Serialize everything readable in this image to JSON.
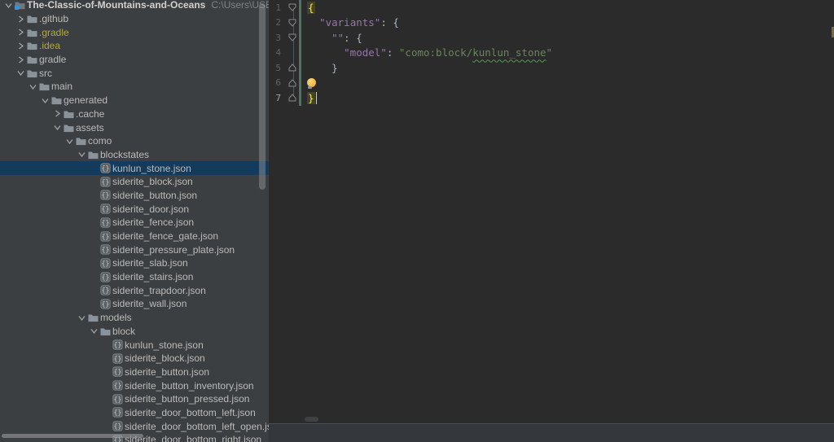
{
  "colors": {
    "panel_bg": "#3C3F41",
    "editor_bg": "#2B2B2B",
    "selection_bg": "#153B5C",
    "excluded_folder": "#B2A943",
    "key": "#9876AA",
    "string": "#6A8759",
    "punct": "#A9B7C6",
    "brace_match": "#FFEF28",
    "line_number": "#606366",
    "vcs_added_stripe": "#4E7560",
    "folder_icon": "#8A939A",
    "root_accent": "#3C8FD2"
  },
  "project_tree": {
    "rows": [
      {
        "label": "The-Classic-of-Mountains-and-Oceans",
        "path": "C:\\Users\\USER\\Deskto",
        "level": 0,
        "kind": "root",
        "state": "expanded"
      },
      {
        "label": ".github",
        "level": 1,
        "kind": "folder",
        "state": "collapsed"
      },
      {
        "label": ".gradle",
        "level": 1,
        "kind": "folder",
        "state": "collapsed",
        "excluded": true
      },
      {
        "label": ".idea",
        "level": 1,
        "kind": "folder",
        "state": "collapsed",
        "excluded": true
      },
      {
        "label": "gradle",
        "level": 1,
        "kind": "folder",
        "state": "collapsed"
      },
      {
        "label": "src",
        "level": 1,
        "kind": "folder",
        "state": "expanded"
      },
      {
        "label": "main",
        "level": 2,
        "kind": "folder",
        "state": "expanded"
      },
      {
        "label": "generated",
        "level": 3,
        "kind": "folder",
        "state": "expanded"
      },
      {
        "label": ".cache",
        "level": 4,
        "kind": "folder",
        "state": "collapsed"
      },
      {
        "label": "assets",
        "level": 4,
        "kind": "folder",
        "state": "expanded"
      },
      {
        "label": "como",
        "level": 5,
        "kind": "folder",
        "state": "expanded"
      },
      {
        "label": "blockstates",
        "level": 6,
        "kind": "folder",
        "state": "expanded"
      },
      {
        "label": "kunlun_stone.json",
        "level": 7,
        "kind": "file",
        "selected": true
      },
      {
        "label": "siderite_block.json",
        "level": 7,
        "kind": "file"
      },
      {
        "label": "siderite_button.json",
        "level": 7,
        "kind": "file"
      },
      {
        "label": "siderite_door.json",
        "level": 7,
        "kind": "file"
      },
      {
        "label": "siderite_fence.json",
        "level": 7,
        "kind": "file"
      },
      {
        "label": "siderite_fence_gate.json",
        "level": 7,
        "kind": "file"
      },
      {
        "label": "siderite_pressure_plate.json",
        "level": 7,
        "kind": "file"
      },
      {
        "label": "siderite_slab.json",
        "level": 7,
        "kind": "file"
      },
      {
        "label": "siderite_stairs.json",
        "level": 7,
        "kind": "file"
      },
      {
        "label": "siderite_trapdoor.json",
        "level": 7,
        "kind": "file"
      },
      {
        "label": "siderite_wall.json",
        "level": 7,
        "kind": "file"
      },
      {
        "label": "models",
        "level": 6,
        "kind": "folder",
        "state": "expanded"
      },
      {
        "label": "block",
        "level": 7,
        "kind": "folder",
        "state": "expanded"
      },
      {
        "label": "kunlun_stone.json",
        "level": 8,
        "kind": "file"
      },
      {
        "label": "siderite_block.json",
        "level": 8,
        "kind": "file"
      },
      {
        "label": "siderite_button.json",
        "level": 8,
        "kind": "file"
      },
      {
        "label": "siderite_button_inventory.json",
        "level": 8,
        "kind": "file"
      },
      {
        "label": "siderite_button_pressed.json",
        "level": 8,
        "kind": "file"
      },
      {
        "label": "siderite_door_bottom_left.json",
        "level": 8,
        "kind": "file"
      },
      {
        "label": "siderite_door_bottom_left_open.json",
        "level": 8,
        "kind": "file"
      },
      {
        "label": "siderite_door_bottom_right.json",
        "level": 8,
        "kind": "file"
      }
    ]
  },
  "editor": {
    "cursor_line": 7,
    "bulb_line": 6,
    "lines": [
      {
        "num": "1",
        "fold": "start",
        "tokens": [
          [
            "m",
            "{"
          ]
        ]
      },
      {
        "num": "2",
        "fold": "start",
        "tokens": [
          [
            "w",
            "  "
          ],
          [
            "k",
            "\"variants\""
          ],
          [
            "p",
            ":"
          ],
          [
            "w",
            " "
          ],
          [
            "p",
            "{"
          ]
        ]
      },
      {
        "num": "3",
        "fold": "start",
        "tokens": [
          [
            "w",
            "    "
          ],
          [
            "k",
            "\"\""
          ],
          [
            "p",
            ":"
          ],
          [
            "w",
            " "
          ],
          [
            "p",
            "{"
          ]
        ]
      },
      {
        "num": "4",
        "fold": null,
        "tokens": [
          [
            "w",
            "      "
          ],
          [
            "k",
            "\"model\""
          ],
          [
            "p",
            ":"
          ],
          [
            "w",
            " "
          ],
          [
            "s",
            "\"como:block/"
          ],
          [
            "st",
            "kunlun_stone"
          ],
          [
            "s",
            "\""
          ]
        ]
      },
      {
        "num": "5",
        "fold": "end",
        "tokens": [
          [
            "w",
            "    "
          ],
          [
            "p",
            "}"
          ]
        ]
      },
      {
        "num": "6",
        "fold": "end",
        "tokens": []
      },
      {
        "num": "7",
        "fold": "end",
        "tokens": [
          [
            "m",
            "}"
          ]
        ]
      }
    ]
  }
}
